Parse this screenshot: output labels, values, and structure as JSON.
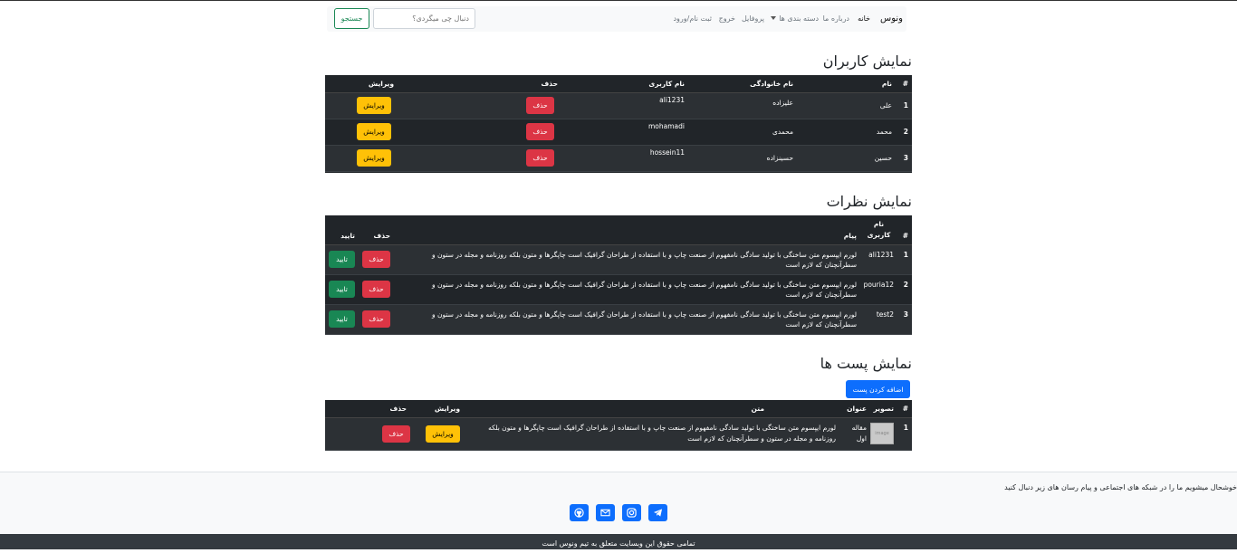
{
  "navbar": {
    "brand": "ونوس",
    "links": {
      "home": "خانه",
      "about": "درباره ما",
      "categories": "دسته بندی ها",
      "profile": "پروفایل",
      "logout": "خروج",
      "register": "ثبت نام/ورود"
    },
    "search": {
      "placeholder": "دنبال چی میگردی؟",
      "button": "جستجو"
    }
  },
  "users": {
    "title": "نمایش کاربران",
    "headers": {
      "num": "#",
      "name": "نام",
      "family": "نام خانوادگی",
      "username": "نام کاربری",
      "delete": "حذف",
      "edit": "ویرایش"
    },
    "rows": [
      {
        "num": "1",
        "name": "علی",
        "family": "علیزاده",
        "username": "ali1231",
        "delete": "حذف",
        "edit": "ویرایش"
      },
      {
        "num": "2",
        "name": "محمد",
        "family": "محمدی",
        "username": "mohamadi",
        "delete": "حذف",
        "edit": "ویرایش"
      },
      {
        "num": "3",
        "name": "حسین",
        "family": "حسینزاده",
        "username": "hossein11",
        "delete": "حذف",
        "edit": "ویرایش"
      }
    ]
  },
  "comments": {
    "title": "نمایش نظرات",
    "headers": {
      "num": "#",
      "username": "نام کاربری",
      "message": "پیام",
      "delete": "حذف",
      "approve": "تایید"
    },
    "rows": [
      {
        "num": "1",
        "username": "ali1231",
        "message": "لورم ایپسوم متن ساختگی با تولید سادگی نامفهوم از صنعت چاپ و با استفاده از طراحان گرافیک است چاپگرها و متون بلکه روزنامه و مجله در ستون و سطرآنچنان که لازم است",
        "delete": "حذف",
        "approve": "تایید"
      },
      {
        "num": "2",
        "username": "pouria12",
        "message": "لورم ایپسوم متن ساختگی با تولید سادگی نامفهوم از صنعت چاپ و با استفاده از طراحان گرافیک است چاپگرها و متون بلکه روزنامه و مجله در ستون و سطرآنچنان که لازم است",
        "delete": "حذف",
        "approve": "تایید"
      },
      {
        "num": "3",
        "username": "test2",
        "message": "لورم ایپسوم متن ساختگی با تولید سادگی نامفهوم از صنعت چاپ و با استفاده از طراحان گرافیک است چاپگرها و متون بلکه روزنامه و مجله در ستون و سطرآنچنان که لازم است",
        "delete": "حذف",
        "approve": "تایید"
      }
    ]
  },
  "posts": {
    "title": "نمایش پست ها",
    "add_button": "اضافه کردن پست",
    "headers": {
      "num": "#",
      "image": "تصویر",
      "title": "عنوان",
      "text": "متن",
      "edit": "ویرایش",
      "delete": "حذف"
    },
    "rows": [
      {
        "num": "1",
        "image_alt": "image",
        "title": "مقاله اول",
        "text": "لورم ایپسوم متن ساختگی با تولید سادگی نامفهوم از صنعت چاپ و با استفاده از طراحان گرافیک است چاپگرها و متون بلکه روزنامه و مجله در ستون و سطرآنچنان که لازم است",
        "edit": "ویرایش",
        "delete": "حذف"
      }
    ]
  },
  "footer": {
    "message": "خوشحال میشویم ما را در شبکه های اجتماعی و پیام رسان های زیر دنبال کنید",
    "social": [
      "telegram-icon",
      "instagram-icon",
      "email-icon",
      "github-icon"
    ],
    "copyright": "تمامی حقوق این وبسایت متعلق به تیم ونوس است"
  },
  "colors": {
    "danger": "#dc3545",
    "warning": "#ffc107",
    "success": "#198754",
    "primary": "#0d6efd",
    "table_dark": "#212529"
  }
}
